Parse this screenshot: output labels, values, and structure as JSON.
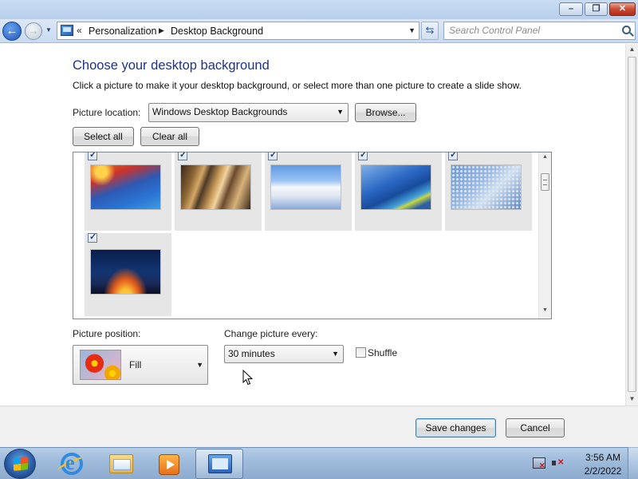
{
  "window": {
    "title_buttons": {
      "minimize": "minimize",
      "maximize": "maximize",
      "close": "close"
    }
  },
  "nav": {
    "breadcrumb_overflow": "«",
    "breadcrumbs": [
      "Personalization",
      "Desktop Background"
    ],
    "search_placeholder": "Search Control Panel"
  },
  "main": {
    "title": "Choose your desktop background",
    "description": "Click a picture to make it your desktop background, or select more than one picture to create a slide show.",
    "picture_location_label": "Picture location:",
    "picture_location_value": "Windows Desktop Backgrounds",
    "browse_label": "Browse...",
    "select_all_label": "Select all",
    "clear_all_label": "Clear all",
    "pictures": [
      {
        "checked": true,
        "icon": "space-needle-image"
      },
      {
        "checked": true,
        "icon": "abstract-metal-image"
      },
      {
        "checked": true,
        "icon": "white-building-image"
      },
      {
        "checked": true,
        "icon": "blue-building-image"
      },
      {
        "checked": true,
        "icon": "dotted-facade-image"
      },
      {
        "checked": true,
        "icon": "sunset-arches-image"
      }
    ],
    "picture_position_label": "Picture position:",
    "picture_position_value": "Fill",
    "change_picture_label": "Change picture every:",
    "change_picture_value": "30 minutes",
    "shuffle_label": "Shuffle",
    "shuffle_checked": false
  },
  "footer": {
    "save_label": "Save changes",
    "cancel_label": "Cancel"
  },
  "taskbar": {
    "items": [
      "start-button",
      "internet-explorer-icon",
      "windows-explorer-icon",
      "media-player-icon",
      "control-panel-icon"
    ],
    "active_item": "control-panel-icon",
    "clock_time": "3:56 AM",
    "clock_date": "2/2/2022"
  },
  "colors": {
    "title_blue": "#1e3287",
    "taskbar": "#9fbcdc",
    "footer_bg": "#f0f0f0"
  }
}
